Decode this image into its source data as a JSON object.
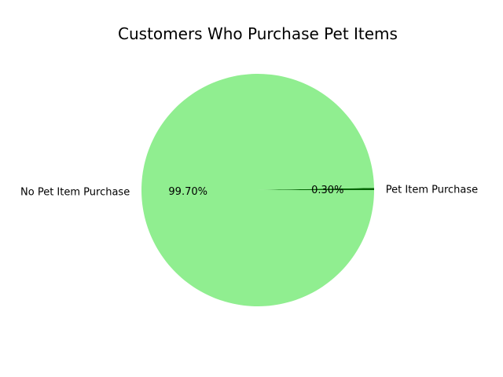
{
  "chart_data": {
    "type": "pie",
    "title": "Customers Who Purchase Pet Items",
    "slices": [
      {
        "label": "Pet Item Purchase",
        "value": 0.3,
        "pct_label": "0.30%",
        "color": "#006400"
      },
      {
        "label": "No Pet Item Purchase",
        "value": 99.7,
        "pct_label": "99.70%",
        "color": "#90ee90"
      }
    ],
    "start_angle_deg": 0,
    "direction": "counterclockwise"
  }
}
